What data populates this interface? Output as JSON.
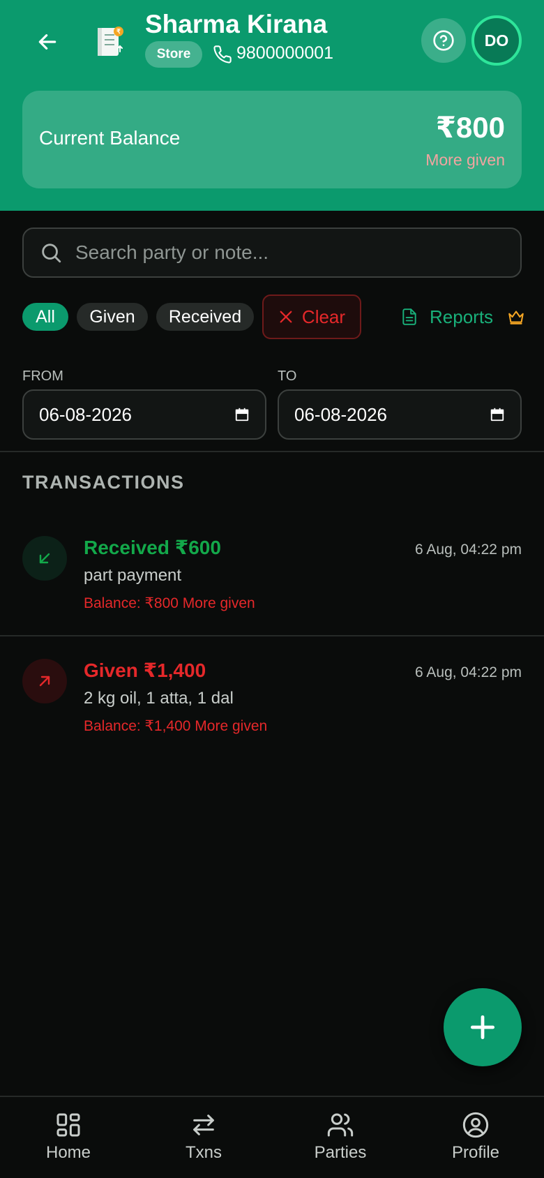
{
  "header": {
    "title": "Sharma Kirana",
    "badge": "Store",
    "phone": "9800000001",
    "avatar_initials": "DO"
  },
  "balance": {
    "label": "Current Balance",
    "amount": "₹800",
    "status": "More given"
  },
  "search": {
    "placeholder": "Search party or note...",
    "value": ""
  },
  "filters": {
    "all": "All",
    "given": "Given",
    "received": "Received",
    "clear": "Clear",
    "reports": "Reports",
    "active": "All"
  },
  "date_range": {
    "from_label": "FROM",
    "from_value": "06-08-2026",
    "to_label": "TO",
    "to_value": "06-08-2026"
  },
  "transactions_title": "TRANSACTIONS",
  "transactions": [
    {
      "type": "received",
      "title": "Received ₹600",
      "time": "6 Aug, 04:22 pm",
      "note": "part payment",
      "balance": "Balance: ₹800 More given"
    },
    {
      "type": "given",
      "title": "Given ₹1,400",
      "time": "6 Aug, 04:22 pm",
      "note": "2 kg oil, 1 atta, 1 dal",
      "balance": "Balance: ₹1,400 More given"
    }
  ],
  "nav": {
    "home": "Home",
    "txns": "Txns",
    "parties": "Parties",
    "profile": "Profile"
  },
  "colors": {
    "brand": "#0b9a6d",
    "received": "#13a84a",
    "given": "#e5282a",
    "premium": "#f5a623"
  },
  "icons": [
    "back-arrow-icon",
    "ledger-icon",
    "phone-icon",
    "help-icon",
    "search-icon",
    "close-icon",
    "document-icon",
    "crown-icon",
    "calendar-icon",
    "arrow-down-left-icon",
    "arrow-up-right-icon",
    "plus-icon",
    "home-icon",
    "swap-icon",
    "users-icon",
    "profile-icon"
  ]
}
